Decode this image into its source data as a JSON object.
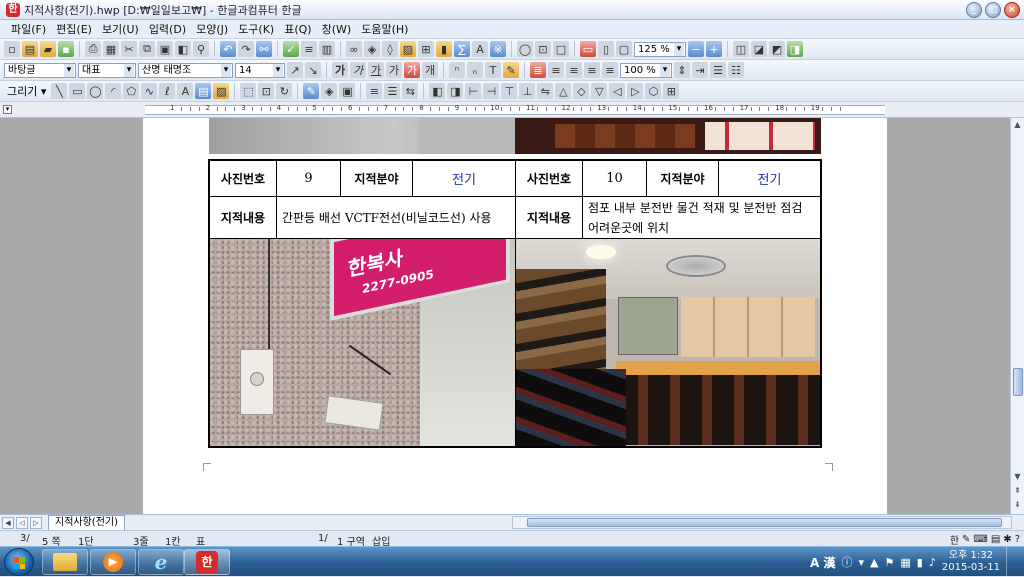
{
  "window": {
    "title": "지적사항(전기).hwp [D:₩일일보고₩] - 한글과컴퓨터 한글",
    "controls": [
      "_",
      "□",
      "×"
    ]
  },
  "menu": [
    "파일(F)",
    "편집(E)",
    "보기(U)",
    "입력(D)",
    "모양(J)",
    "도구(K)",
    "표(Q)",
    "창(W)",
    "도움말(H)"
  ],
  "toolbar": {
    "zoom": "125 %",
    "style": "바탕글",
    "font_kind": "대표",
    "font_name": "산명 태명조",
    "font_size": "14",
    "char_scale": "100 %",
    "draw_label": "그리기 ▾"
  },
  "ruler": {
    "numbers": [
      "1",
      "2",
      "3",
      "4",
      "5",
      "6",
      "7",
      "8",
      "9",
      "10",
      "11",
      "12",
      "13",
      "14",
      "15",
      "16",
      "17",
      "18",
      "19"
    ]
  },
  "table": {
    "left": {
      "photo_no_label": "사진번호",
      "photo_no": "9",
      "field_label": "지적분야",
      "field": "전기",
      "content_label": "지적내용",
      "content": "간판등 배선 VCTF전선(비닐코드선) 사용",
      "sign_text": "한복사",
      "sign_phone": "2277-0905"
    },
    "right": {
      "photo_no_label": "사진번호",
      "photo_no": "10",
      "field_label": "지적분야",
      "field": "전기",
      "content_label": "지적내용",
      "content": "점포 내부 분전반 물건 적재 및 분전반 점검 어려운곳에 위치"
    }
  },
  "tabs": {
    "doc_tab": "지적사항(전기)"
  },
  "status": {
    "page": "3/",
    "section_count": "5 쪽",
    "column": "1단",
    "line": "3줄",
    "col_pos": "1칸",
    "table": "표",
    "section": "1/",
    "section_label": "1 구역",
    "insert": "삽입"
  },
  "ime": {
    "han": "한"
  },
  "taskbar": {
    "lang": "A 漢",
    "time": "오후 1:32",
    "date": "2015-03-11"
  },
  "colors": {
    "accent": "#2b5f94",
    "field_blue": "#2233aa"
  }
}
